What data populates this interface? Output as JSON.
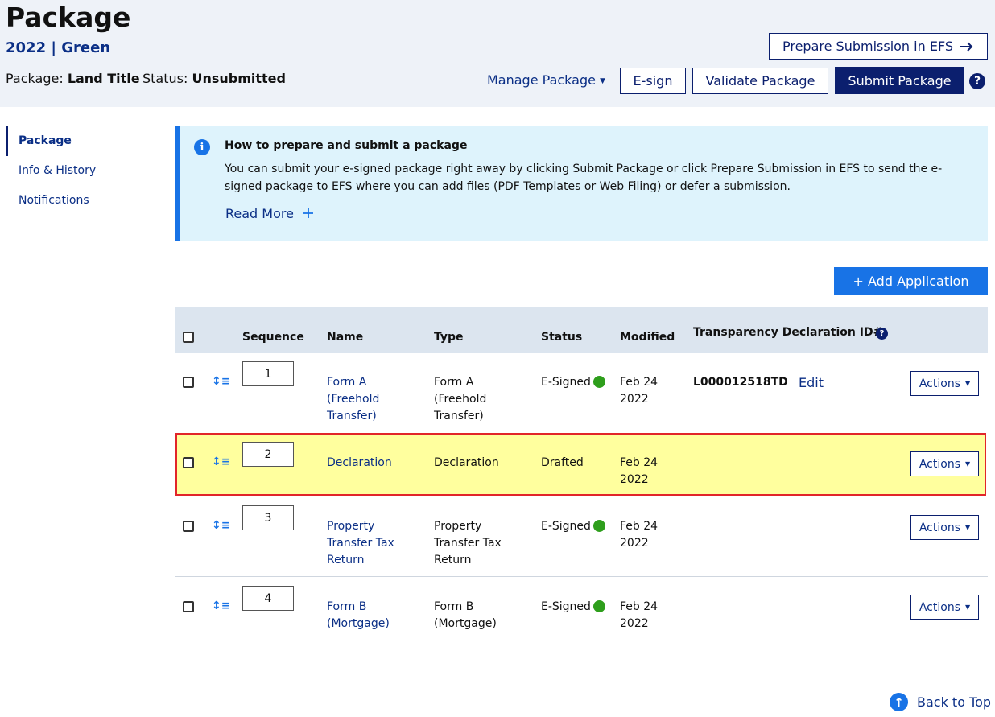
{
  "header": {
    "title": "Package",
    "subtitle": "2022 | Green",
    "package_label": "Package:",
    "package_value": "Land Title",
    "status_label": "Status:",
    "status_value": "Unsubmitted",
    "prepare_button": "Prepare Submission in EFS",
    "manage_label": "Manage Package",
    "esign_button": "E-sign",
    "validate_button": "Validate Package",
    "submit_button": "Submit Package",
    "help_glyph": "?"
  },
  "sidebar": {
    "items": [
      {
        "label": "Package",
        "active": true
      },
      {
        "label": "Info & History",
        "active": false
      },
      {
        "label": "Notifications",
        "active": false
      }
    ]
  },
  "alert": {
    "icon_glyph": "i",
    "title": "How to prepare and submit a package",
    "body": "You can submit your e-signed package right away by clicking Submit Package or click Prepare Submission in EFS to send the e-signed package to EFS where you can add files (PDF Templates or Web Filing) or defer a submission.",
    "read_more": "Read More"
  },
  "add_application": "+ Add Application",
  "table": {
    "headers": {
      "sequence": "Sequence",
      "name": "Name",
      "type": "Type",
      "status": "Status",
      "modified": "Modified",
      "transparency": "Transparency Declaration ID#"
    },
    "actions_label": "Actions",
    "edit_label": "Edit",
    "rows": [
      {
        "sequence": "1",
        "name": "Form A (Freehold Transfer)",
        "type": "Form A (Freehold Transfer)",
        "status": "E-Signed",
        "signed": true,
        "modified": "Feb 24 2022",
        "transparency_id": "L000012518TD"
      },
      {
        "sequence": "2",
        "name": "Declaration",
        "type": "Declaration",
        "status": "Drafted",
        "signed": false,
        "modified": "Feb 24 2022",
        "transparency_id": ""
      },
      {
        "sequence": "3",
        "name": "Property Transfer Tax Return",
        "type": "Property Transfer Tax Return",
        "status": "E-Signed",
        "signed": true,
        "modified": "Feb 24 2022",
        "transparency_id": ""
      },
      {
        "sequence": "4",
        "name": "Form B (Mortgage)",
        "type": "Form B (Mortgage)",
        "status": "E-Signed",
        "signed": true,
        "modified": "Feb 24 2022",
        "transparency_id": ""
      }
    ]
  },
  "back_to_top": "Back to Top",
  "colors": {
    "navy": "#0b1f6e",
    "accent_blue": "#1873e6",
    "highlight": "#ffff9e",
    "highlight_border": "#e1252a",
    "signed_green": "#2e9e1c"
  }
}
